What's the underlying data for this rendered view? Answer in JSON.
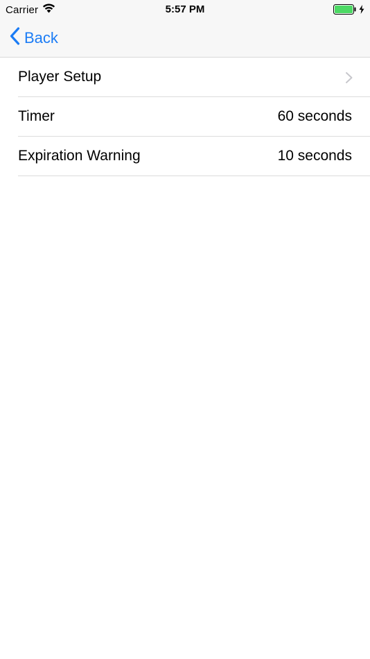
{
  "status_bar": {
    "carrier": "Carrier",
    "time": "5:57 PM",
    "icons": {
      "wifi": "wifi-icon",
      "battery": "battery-icon",
      "charging": "charging-bolt-icon"
    },
    "battery_color": "#4cd964"
  },
  "nav_bar": {
    "back_label": "Back",
    "accent_color": "#1b7cf5"
  },
  "settings": {
    "rows": [
      {
        "label": "Player Setup",
        "value": "",
        "accessory": "chevron-right-icon"
      },
      {
        "label": "Timer",
        "value": "60 seconds"
      },
      {
        "label": "Expiration Warning",
        "value": "10 seconds"
      }
    ]
  }
}
